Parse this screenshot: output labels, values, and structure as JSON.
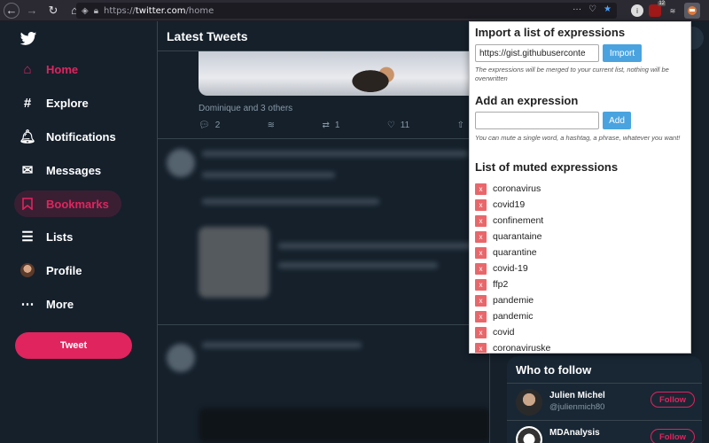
{
  "browser": {
    "url_prefix": "https://",
    "url_host": "twitter.com",
    "url_path": "/home",
    "ext_badge": "12"
  },
  "sidebar": {
    "items": [
      {
        "label": "Home",
        "icon": "home-icon"
      },
      {
        "label": "Explore",
        "icon": "hashtag-icon"
      },
      {
        "label": "Notifications",
        "icon": "bell-icon"
      },
      {
        "label": "Messages",
        "icon": "mail-icon"
      },
      {
        "label": "Bookmarks",
        "icon": "bookmark-icon"
      },
      {
        "label": "Lists",
        "icon": "list-icon"
      },
      {
        "label": "Profile",
        "icon": "avatar"
      },
      {
        "label": "More",
        "icon": "more-icon"
      }
    ],
    "tweet_button": "Tweet",
    "accent": "#e0245e"
  },
  "timeline": {
    "title": "Latest Tweets",
    "liked_by": "Dominique and 3 others",
    "replies": "2",
    "retweets": "1",
    "likes": "11"
  },
  "who_to_follow": {
    "title": "Who to follow",
    "users": [
      {
        "name": "Julien Michel",
        "handle": "@julienmich80",
        "button": "Follow"
      },
      {
        "name": "MDAnalysis",
        "handle": "",
        "button": "Follow"
      }
    ]
  },
  "popup": {
    "import_title": "Import a list of expressions",
    "import_value": "https://gist.githubuserconte",
    "import_button": "Import",
    "import_note": "The expressions will be merged to your current list, nothing will be overwritten",
    "add_title": "Add an expression",
    "add_value": "",
    "add_button": "Add",
    "add_note": "You can mute a single word, a hashtag, a phrase, whatever you want!",
    "list_title": "List of muted expressions",
    "remove_label": "x",
    "muted": [
      "coronavirus",
      "covid19",
      "confinement",
      "quarantaine",
      "quarantine",
      "covid-19",
      "ffp2",
      "pandemie",
      "pandemic",
      "covid",
      "coronaviruske"
    ]
  }
}
